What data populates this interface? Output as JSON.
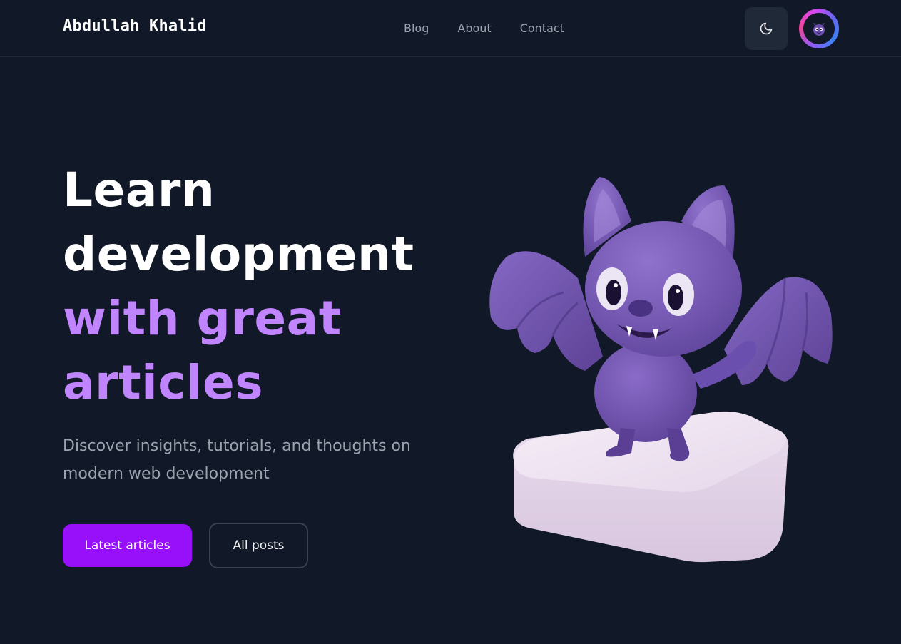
{
  "header": {
    "logo": "Abdullah Khalid",
    "nav": [
      {
        "label": "Blog"
      },
      {
        "label": "About"
      },
      {
        "label": "Contact"
      }
    ],
    "theme_icon": "moon-icon",
    "avatar_icon": "bat-avatar-icon"
  },
  "hero": {
    "title_line1": "Learn",
    "title_line2": "development",
    "title_line3": "with great",
    "title_line4": "articles",
    "subtitle": "Discover insights, tutorials, and thoughts on modern web development",
    "primary_button": "Latest articles",
    "secondary_button": "All posts",
    "illustration": "bat-mascot-illustration"
  },
  "colors": {
    "background": "#111827",
    "accent": "#9810fa",
    "accent_text": "#c084fc",
    "muted_text": "#9ca3af"
  }
}
